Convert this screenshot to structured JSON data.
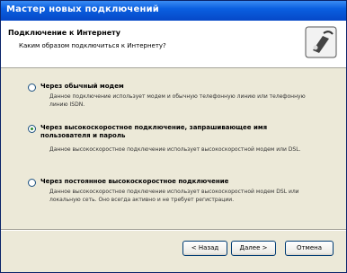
{
  "window": {
    "title": "Мастер новых подключений"
  },
  "header": {
    "title": "Подключение к Интернету",
    "subtitle": "Каким образом подключиться к Интернету?"
  },
  "options": [
    {
      "label": "Через обычный модем",
      "description": "Данное подключение использует модем и обычную телефонную линию или телефонную линию ISDN.",
      "selected": false
    },
    {
      "label": "Через высокоскоростное подключение, запрашивающее имя пользователя и пароль",
      "description": "Данное высокоскоростное подключение использует высокоскоростной модем или DSL.",
      "selected": true
    },
    {
      "label": "Через постоянное высокоскоростное подключение",
      "description": "Данное высокоскоростное подключение использует высокоскоростной модем DSL или локальную сеть. Оно всегда активно и не требует регистрации.",
      "selected": false
    }
  ],
  "buttons": {
    "back": "< Назад",
    "next": "Далее >",
    "cancel": "Отмена"
  },
  "colors": {
    "titlebar": "#0a5fe0",
    "dialog_bg": "#ece9d8"
  },
  "icons": {
    "wizard": "network-wizard-icon"
  }
}
